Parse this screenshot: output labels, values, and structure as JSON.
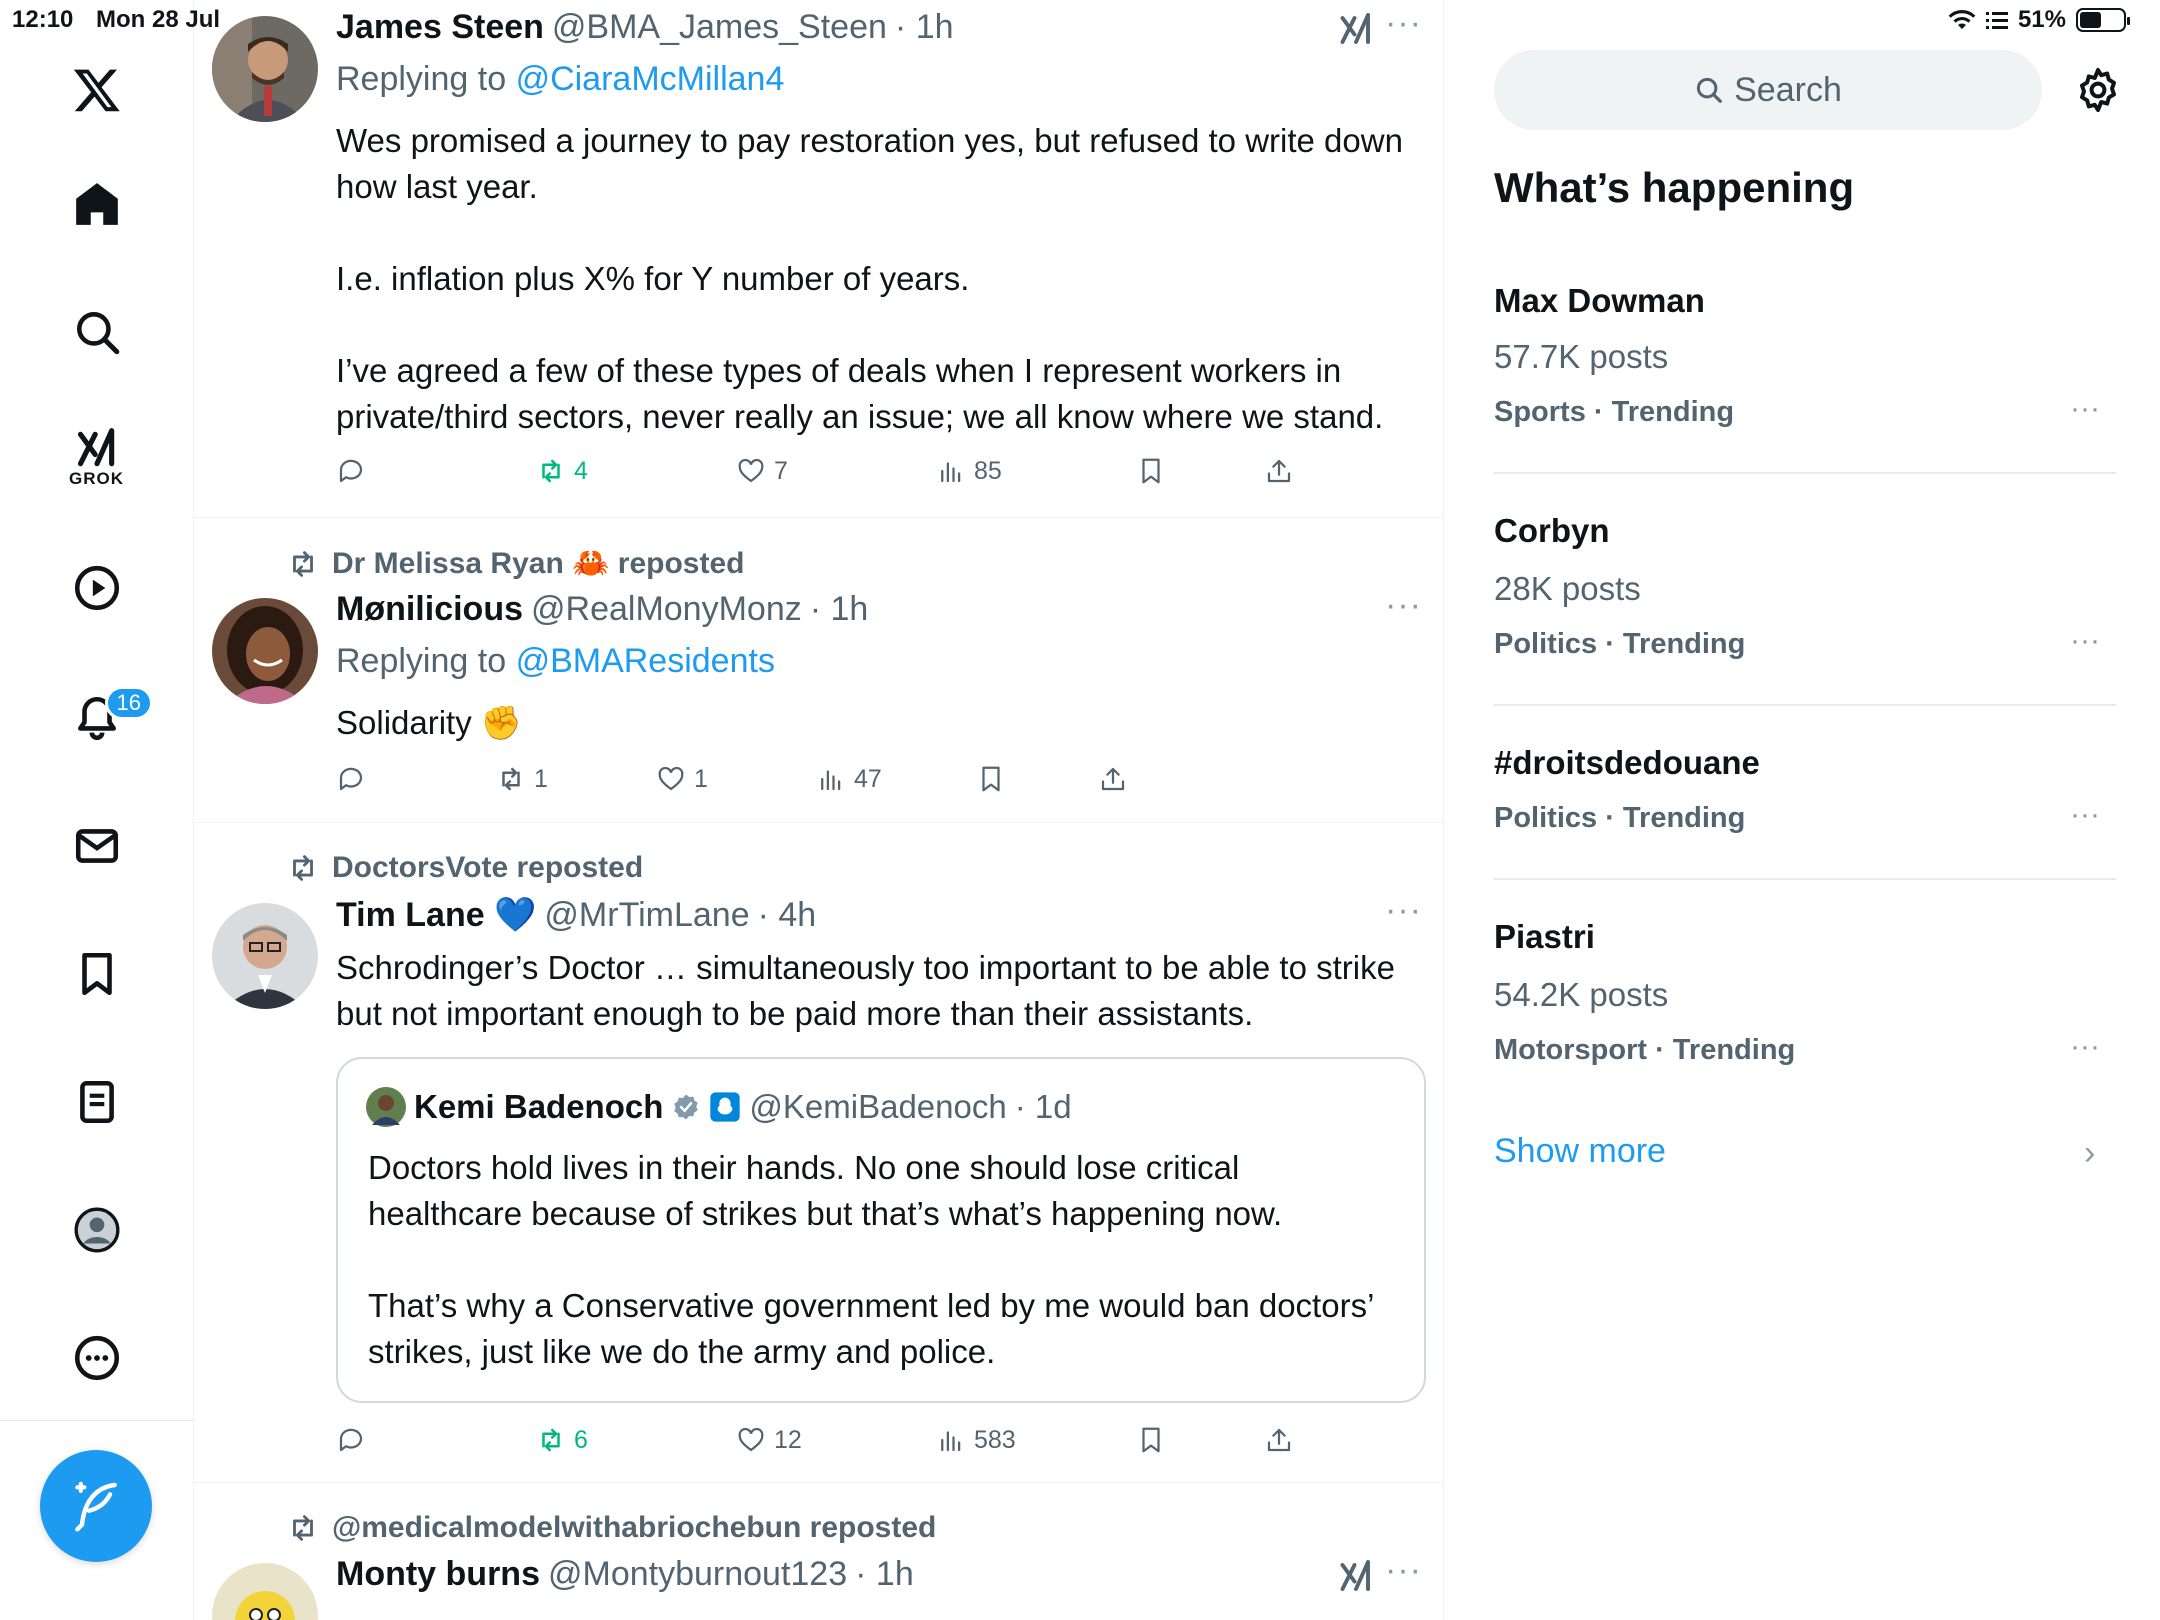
{
  "status_bar": {
    "time": "12:10",
    "date": "Mon 28 Jul",
    "battery": "51%",
    "battery_level": 0.51
  },
  "nav": {
    "grok_label": "GROK",
    "notifications_badge": "16",
    "icons": [
      "x-logo-icon",
      "home-icon",
      "search-icon",
      "grok-icon",
      "video-icon",
      "bell-icon",
      "mail-icon",
      "bookmark-icon",
      "lists-icon",
      "profile-icon",
      "more-circle-icon",
      "compose-icon"
    ]
  },
  "tweets": [
    {
      "name": "James Steen",
      "handle": "@BMA_James_Steen",
      "time": "· 1h",
      "reply_label": "Replying to",
      "reply_to": "@CiaraMcMillan4",
      "paragraphs": [
        "Wes promised a journey to pay restoration yes, but refused to write down how last year.",
        "I.e. inflation plus X% for Y number of years.",
        "I’ve agreed a few of these types of deals when I represent workers in private/third sectors, never really an issue; we all know where we stand."
      ],
      "stats": {
        "replies": "",
        "reposts": "4",
        "likes": "7",
        "views": "85"
      }
    },
    {
      "reposted_by": "Dr Melissa Ryan 🦀 reposted",
      "name": "Mønilicious",
      "handle": "@RealMonyMonz",
      "time": "· 1h",
      "reply_label": "Replying to",
      "reply_to": "@BMAResidents",
      "paragraphs": [
        "Solidarity ✊"
      ],
      "stats": {
        "replies": "",
        "reposts": "1",
        "likes": "1",
        "views": "47"
      }
    },
    {
      "reposted_by": "DoctorsVote reposted",
      "name": "Tim Lane 💙",
      "handle": "@MrTimLane",
      "time": "· 4h",
      "paragraphs": [
        "Schrodinger’s Doctor … simultaneously too important to be able to strike but not important enough to be paid more than their assistants."
      ],
      "quote": {
        "name": "Kemi Badenoch",
        "handle": "@KemiBadenoch",
        "time": "· 1d",
        "paragraphs": [
          "Doctors hold lives in their hands. No one should lose critical healthcare because of strikes but that’s what’s happening now.",
          "That’s why a Conservative government led by me would ban doctors’ strikes, just like we do the army and police."
        ]
      },
      "stats": {
        "replies": "",
        "reposts": "6",
        "likes": "12",
        "views": "583"
      }
    },
    {
      "reposted_by": "@medicalmodelwithabriochebun reposted",
      "name": "Monty burns",
      "handle": "@Montyburnout123",
      "time": "· 1h"
    }
  ],
  "right": {
    "search_placeholder": "Search",
    "whats_happening": "What’s happening",
    "trends": [
      {
        "name": "Max Dowman",
        "posts": "57.7K posts",
        "category": "Sports · Trending"
      },
      {
        "name": "Corbyn",
        "posts": "28K posts",
        "category": "Politics · Trending"
      },
      {
        "name": "#droitsdedouane",
        "posts": "",
        "category": "Politics · Trending"
      },
      {
        "name": "Piastri",
        "posts": "54.2K posts",
        "category": "Motorsport · Trending"
      }
    ],
    "show_more": "Show more"
  },
  "colors": {
    "accent": "#1d9bf0",
    "repost_green": "#00ba7c",
    "muted": "#536471"
  }
}
